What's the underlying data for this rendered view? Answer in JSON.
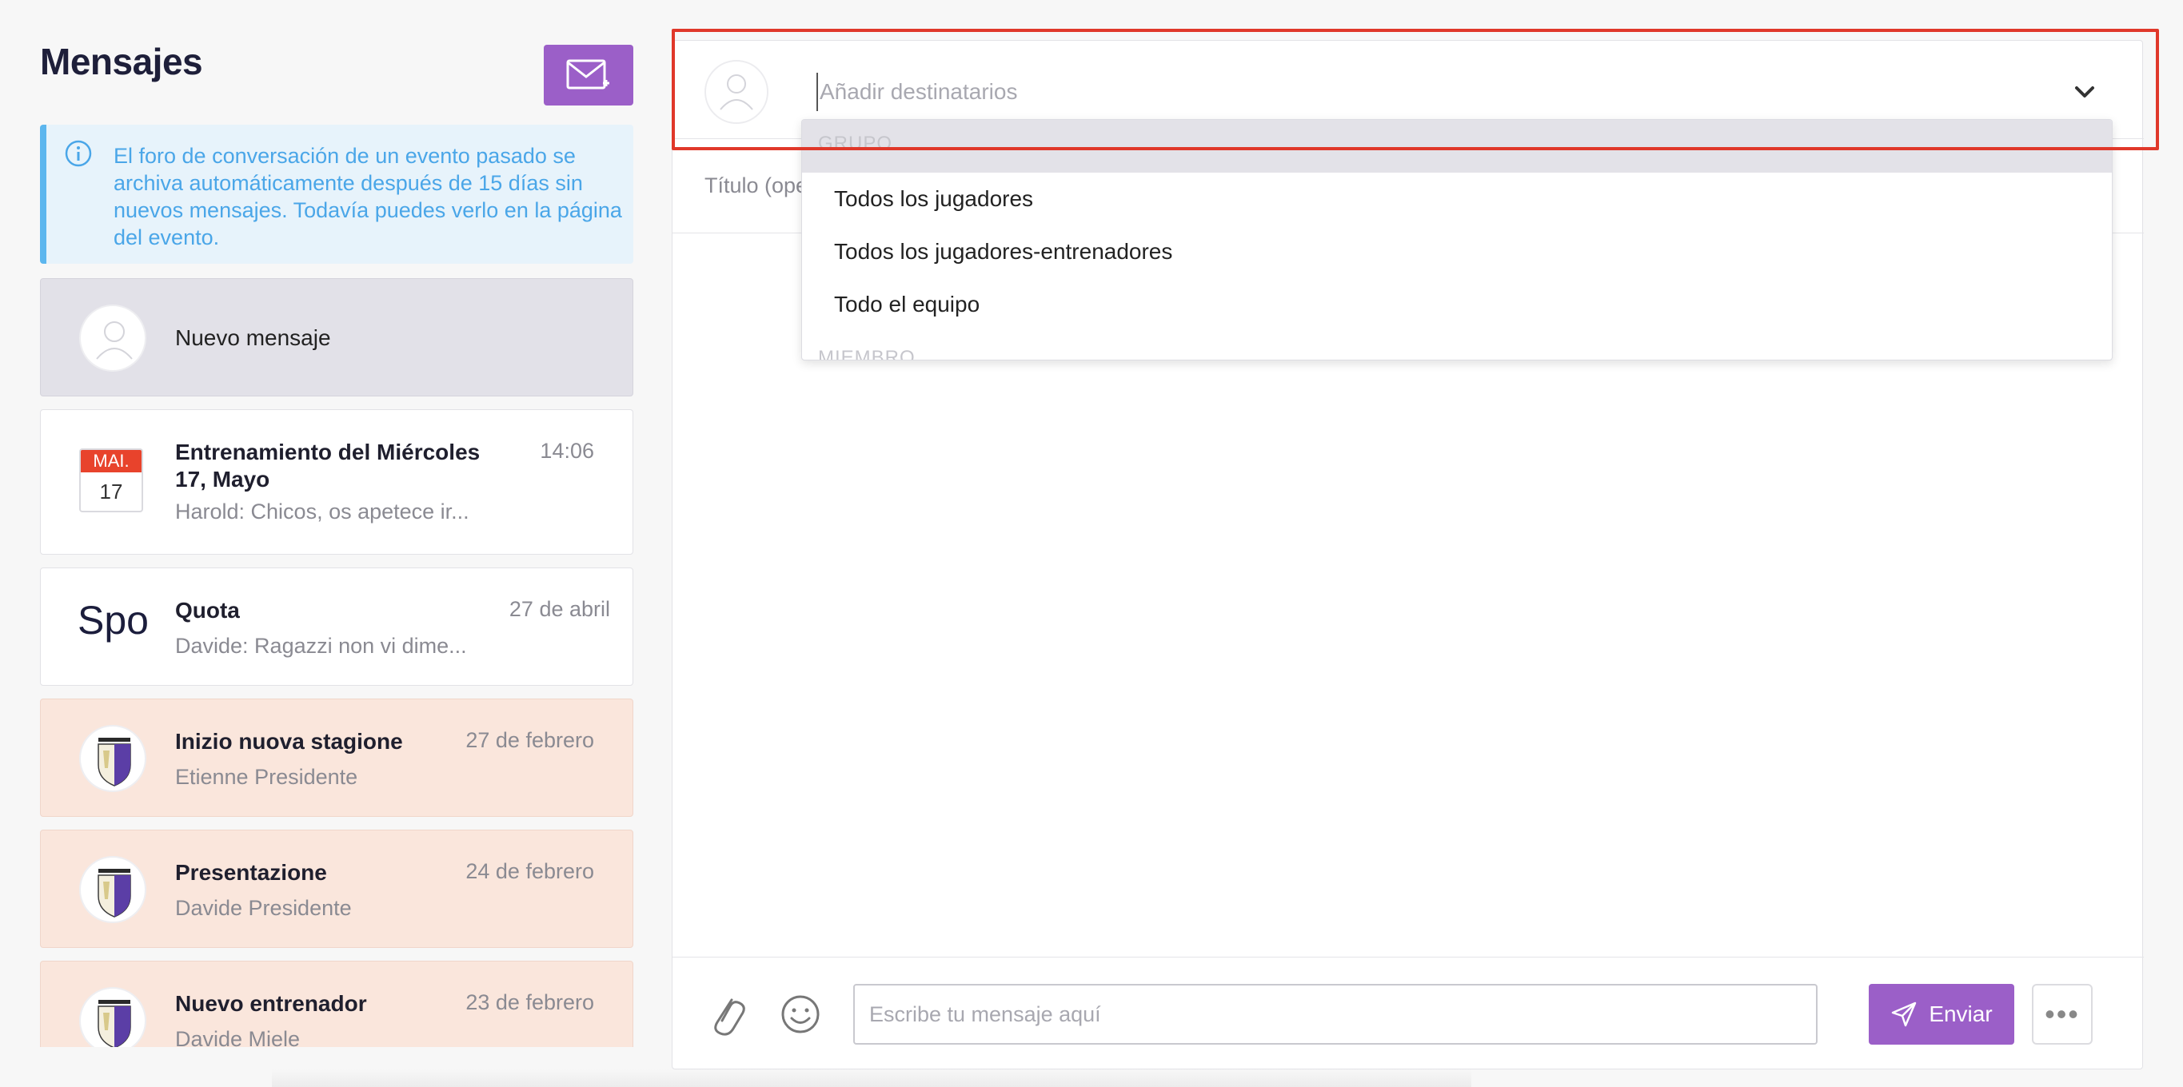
{
  "header": {
    "title": "Mensajes"
  },
  "info_banner": {
    "text": "El foro de conversación de un evento pasado se archiva automáticamente después de 15 días sin nuevos mensajes. Todavía puedes verlo en la página del evento."
  },
  "conversations": {
    "new_message": {
      "label": "Nuevo mensaje"
    },
    "items": [
      {
        "title": "Entrenamiento del Miércoles 17, Mayo",
        "subtitle": "Harold: Chicos, os apetece ir...",
        "date": "14:06",
        "calendar_month": "MAI.",
        "calendar_day": "17"
      },
      {
        "title": "Quota",
        "subtitle": "Davide: Ragazzi non vi dime...",
        "date": "27 de abril",
        "avatar_text": "Spo"
      },
      {
        "title": "Inizio nuova stagione",
        "subtitle": "Etienne Presidente",
        "date": "27 de febrero"
      },
      {
        "title": "Presentazione",
        "subtitle": "Davide Presidente",
        "date": "24 de febrero"
      },
      {
        "title": "Nuevo entrenador",
        "subtitle": "Davide Miele",
        "date": "23 de febrero"
      }
    ]
  },
  "composer": {
    "recipients_placeholder": "Añadir destinatarios",
    "title_placeholder": "Título (ope",
    "dropdown": {
      "group_header": "GRUPO",
      "options": [
        "Todos los jugadores",
        "Todos los jugadores-entrenadores",
        "Todo el equipo"
      ],
      "member_header": "MIEMBRO"
    },
    "message_placeholder": "Escribe tu mensaje aquí",
    "send_label": "Enviar"
  },
  "colors": {
    "accent": "#9b5fc8",
    "info": "#4aa6e8",
    "highlight": "#e0382a",
    "calendar_red": "#e8432c"
  }
}
